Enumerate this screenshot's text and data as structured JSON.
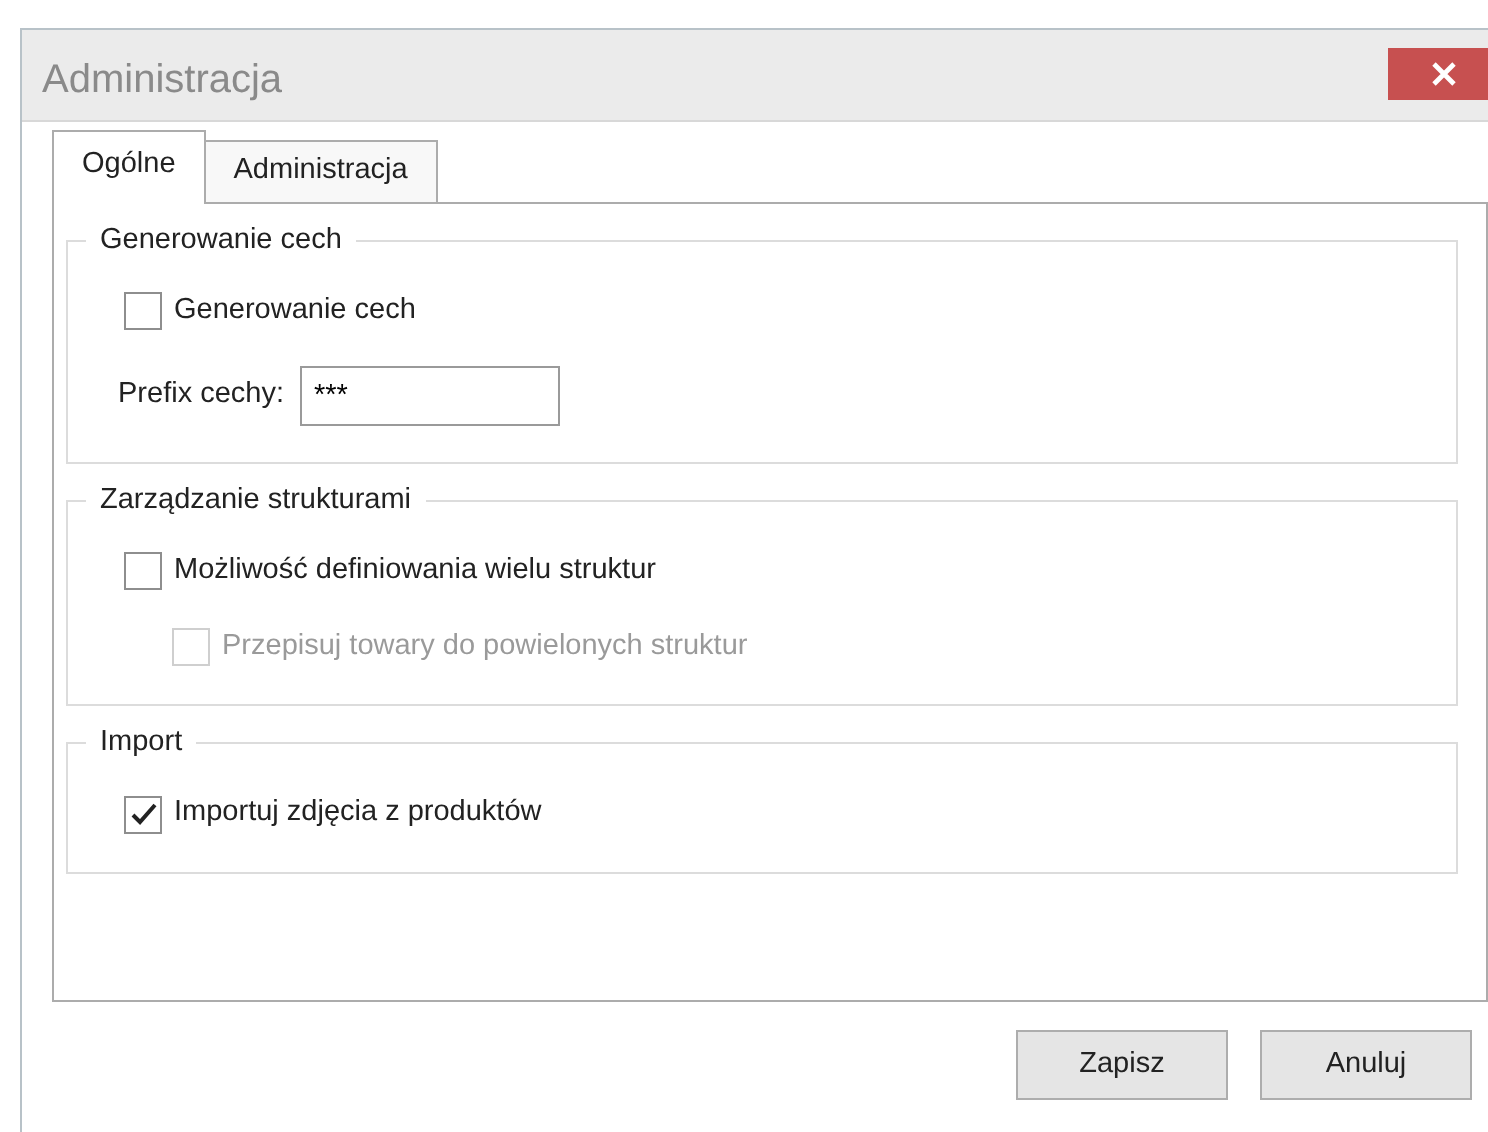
{
  "window": {
    "title": "Administracja"
  },
  "tabs": [
    {
      "label": "Ogólne",
      "selected": true
    },
    {
      "label": "Administracja",
      "selected": false
    }
  ],
  "groups": [
    {
      "title": "Generowanie cech",
      "items": [
        {
          "kind": "checkbox",
          "label": "Generowanie cech",
          "checked": false,
          "disabled": false
        },
        {
          "kind": "field",
          "label": "Prefix cechy:",
          "value": "***"
        }
      ]
    },
    {
      "title": "Zarządzanie strukturami",
      "items": [
        {
          "kind": "checkbox",
          "label": "Możliwość definiowania wielu struktur",
          "checked": false,
          "disabled": false,
          "children": [
            {
              "kind": "checkbox",
              "label": "Przepisuj towary do powielonych struktur",
              "checked": false,
              "disabled": true
            }
          ]
        }
      ]
    },
    {
      "title": "Import",
      "items": [
        {
          "kind": "checkbox",
          "label": "Importuj zdjęcia z produktów",
          "checked": true,
          "disabled": false
        }
      ]
    }
  ],
  "buttons": [
    "Zapisz",
    "Anuluj"
  ]
}
